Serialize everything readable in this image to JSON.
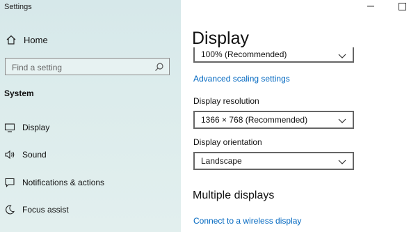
{
  "window": {
    "title": "Settings"
  },
  "sidebar": {
    "home_label": "Home",
    "search_placeholder": "Find a setting",
    "section_label": "System",
    "items": [
      {
        "label": "Display",
        "icon": "monitor-icon"
      },
      {
        "label": "Sound",
        "icon": "speaker-icon"
      },
      {
        "label": "Notifications & actions",
        "icon": "message-icon"
      },
      {
        "label": "Focus assist",
        "icon": "moon-icon"
      }
    ]
  },
  "main": {
    "title": "Display",
    "scale_value": "100% (Recommended)",
    "advanced_scaling_link": "Advanced scaling settings",
    "resolution_label": "Display resolution",
    "resolution_value": "1366 × 768 (Recommended)",
    "orientation_label": "Display orientation",
    "orientation_value": "Landscape",
    "multiple_displays_title": "Multiple displays",
    "wireless_link": "Connect to a wireless display"
  },
  "colors": {
    "accent": "#0067c0",
    "sidebar_bg": "#dcecec"
  }
}
